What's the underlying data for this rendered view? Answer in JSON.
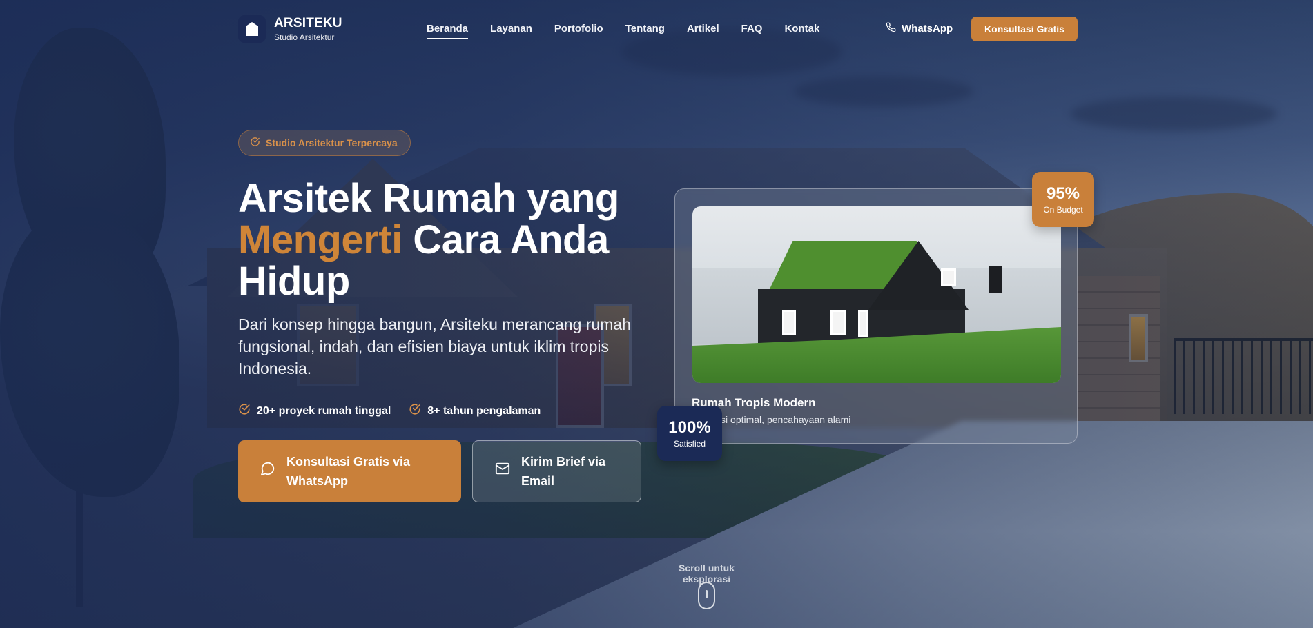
{
  "brand": {
    "name": "ARSITEKU",
    "tagline": "Studio Arsitektur",
    "logo_icon": "house-icon"
  },
  "nav": {
    "items": [
      {
        "label": "Beranda",
        "active": true
      },
      {
        "label": "Layanan"
      },
      {
        "label": "Portofolio"
      },
      {
        "label": "Tentang"
      },
      {
        "label": "Artikel"
      },
      {
        "label": "FAQ"
      },
      {
        "label": "Kontak"
      }
    ],
    "whatsapp_label": "WhatsApp",
    "cta_label": "Konsultasi Gratis"
  },
  "hero": {
    "badge": "Studio Arsitektur Terpercaya",
    "title_line1": "Arsitek Rumah yang",
    "title_accent": "Mengerti",
    "title_line2_rest": " Cara Anda",
    "title_line3": "Hidup",
    "description": "Dari konsep hingga bangun, Arsiteku merancang rumah fungsional, indah, dan efisien biaya untuk iklim tropis Indonesia.",
    "features": [
      "20+ proyek rumah tinggal",
      "8+ tahun pengalaman"
    ],
    "primary_cta": {
      "line1": "Konsultasi Gratis via",
      "line2": "WhatsApp"
    },
    "secondary_cta": {
      "line1": "Kirim Brief via",
      "line2": "Email"
    }
  },
  "showcase": {
    "title": "Rumah Tropis Modern",
    "subtitle": "Ventilasi optimal, pencahayaan alami",
    "stat_budget": {
      "value": "95%",
      "label": "On Budget"
    },
    "stat_satisfied": {
      "value": "100%",
      "label": "Satisfied"
    }
  },
  "scroll_hint": "Scroll untuk eksplorasi",
  "colors": {
    "accent": "#c9803a",
    "navy": "#1b2a56",
    "overlay": "#1a2a54"
  }
}
